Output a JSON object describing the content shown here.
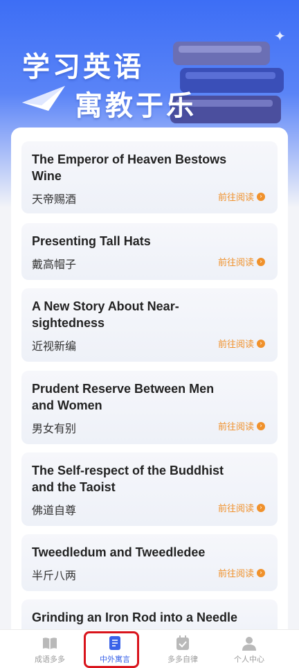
{
  "hero": {
    "line1": "学习英语",
    "line2": "寓教于乐"
  },
  "stories": [
    {
      "title": "The Emperor of Heaven Bestows Wine",
      "cn": "天帝赐酒",
      "action": "前往阅读"
    },
    {
      "title": "Presenting Tall Hats",
      "cn": "戴高帽子",
      "action": "前往阅读"
    },
    {
      "title": "A New Story About Near-sightedness",
      "cn": "近视新编",
      "action": "前往阅读"
    },
    {
      "title": "Prudent Reserve Between Men and Women",
      "cn": "男女有别",
      "action": "前往阅读"
    },
    {
      "title": "The Self-respect of the Buddhist and the Taoist",
      "cn": "佛道自尊",
      "action": "前往阅读"
    },
    {
      "title": "Tweedledum and Tweedledee",
      "cn": "半斤八两",
      "action": "前往阅读"
    },
    {
      "title": "Grinding an Iron Rod into a Needle",
      "cn": "",
      "action": ""
    }
  ],
  "tabs": [
    {
      "label": "成语多多",
      "icon": "book-open-icon"
    },
    {
      "label": "中外寓言",
      "icon": "document-icon"
    },
    {
      "label": "多多自律",
      "icon": "calendar-check-icon"
    },
    {
      "label": "个人中心",
      "icon": "person-icon"
    }
  ],
  "colors": {
    "accent": "#3a63e8",
    "action": "#f0912b",
    "highlight": "#d9131b"
  }
}
